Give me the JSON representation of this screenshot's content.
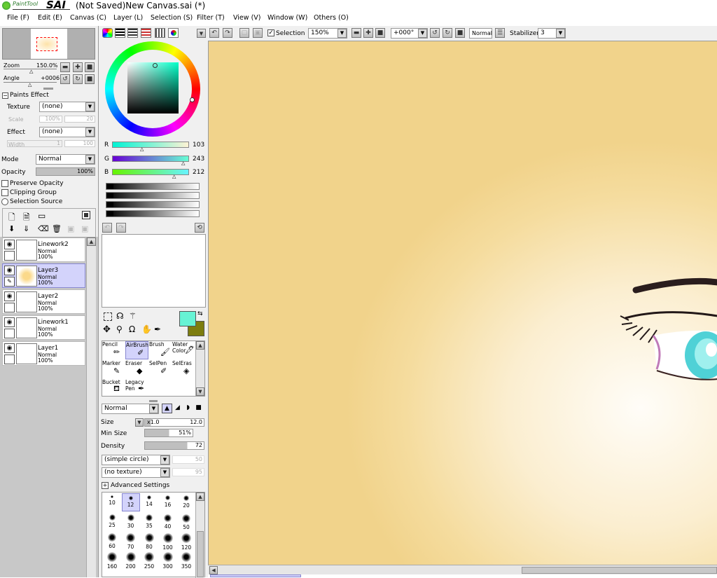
{
  "title": {
    "app_logo_small": "PaintTool",
    "app_logo_big": "SAI",
    "window_title": "(Not Saved)New Canvas.sai (*)"
  },
  "menu": [
    "File (F)",
    "Edit (E)",
    "Canvas (C)",
    "Layer (L)",
    "Selection (S)",
    "Filter (T)",
    "View (V)",
    "Window (W)",
    "Others (O)"
  ],
  "toolbar": {
    "selection_label": "Selection",
    "zoom": "150%",
    "angle": "+000°",
    "blend": "Normal",
    "stabilizer_label": "Stabilizer",
    "stabilizer_value": "3"
  },
  "navigator": {
    "zoom_label": "Zoom",
    "zoom_value": "150.0%",
    "angle_label": "Angle",
    "angle_value": "+0006"
  },
  "paint_effect": {
    "header": "Paints Effect",
    "texture_label": "Texture",
    "texture_value": "(none)",
    "scale_label": "Scale",
    "scale_value": "100%",
    "scale_num": "20",
    "effect_label": "Effect",
    "effect_value": "(none)",
    "width_label": "Width",
    "width_value": "1",
    "width_num": "100"
  },
  "layer_props": {
    "mode_label": "Mode",
    "mode_value": "Normal",
    "opacity_label": "Opacity",
    "opacity_value": "100%",
    "preserve_opacity": "Preserve Opacity",
    "clipping_group": "Clipping Group",
    "selection_source": "Selection Source"
  },
  "layers": [
    {
      "name": "Linework2",
      "mode": "Normal",
      "opacity": "100%"
    },
    {
      "name": "Layer3",
      "mode": "Normal",
      "opacity": "100%"
    },
    {
      "name": "Layer2",
      "mode": "Normal",
      "opacity": "100%"
    },
    {
      "name": "Linework1",
      "mode": "Normal",
      "opacity": "100%"
    },
    {
      "name": "Layer1",
      "mode": "Normal",
      "opacity": "100%"
    }
  ],
  "color": {
    "r_label": "R",
    "r": "103",
    "g_label": "G",
    "g": "243",
    "b_label": "B",
    "b": "212",
    "primary": "#67f3d4",
    "secondary": "#7d7d10"
  },
  "tools": [
    {
      "l1": "Pencil",
      "l2": ""
    },
    {
      "l1": "AirBrush",
      "l2": ""
    },
    {
      "l1": "Brush",
      "l2": ""
    },
    {
      "l1": "Water",
      "l2": "Color"
    },
    {
      "l1": "Marker",
      "l2": ""
    },
    {
      "l1": "Eraser",
      "l2": ""
    },
    {
      "l1": "SelPen",
      "l2": ""
    },
    {
      "l1": "SelEras",
      "l2": ""
    },
    {
      "l1": "Bucket",
      "l2": ""
    },
    {
      "l1": "Legacy",
      "l2": "Pen"
    }
  ],
  "brush_settings": {
    "mode": "Normal",
    "size_label": "Size",
    "size_mult": "x1.0",
    "size_value": "12.0",
    "minsize_label": "Min Size",
    "minsize_value": "51%",
    "density_label": "Density",
    "density_value": "72",
    "shape": "(simple circle)",
    "shape_num": "50",
    "texture": "(no texture)",
    "texture_num": "95",
    "advanced": "Advanced Settings"
  },
  "brush_sizes": [
    "10",
    "12",
    "14",
    "16",
    "20",
    "25",
    "30",
    "35",
    "40",
    "50",
    "60",
    "70",
    "80",
    "100",
    "120",
    "160",
    "200",
    "250",
    "300",
    "350"
  ]
}
